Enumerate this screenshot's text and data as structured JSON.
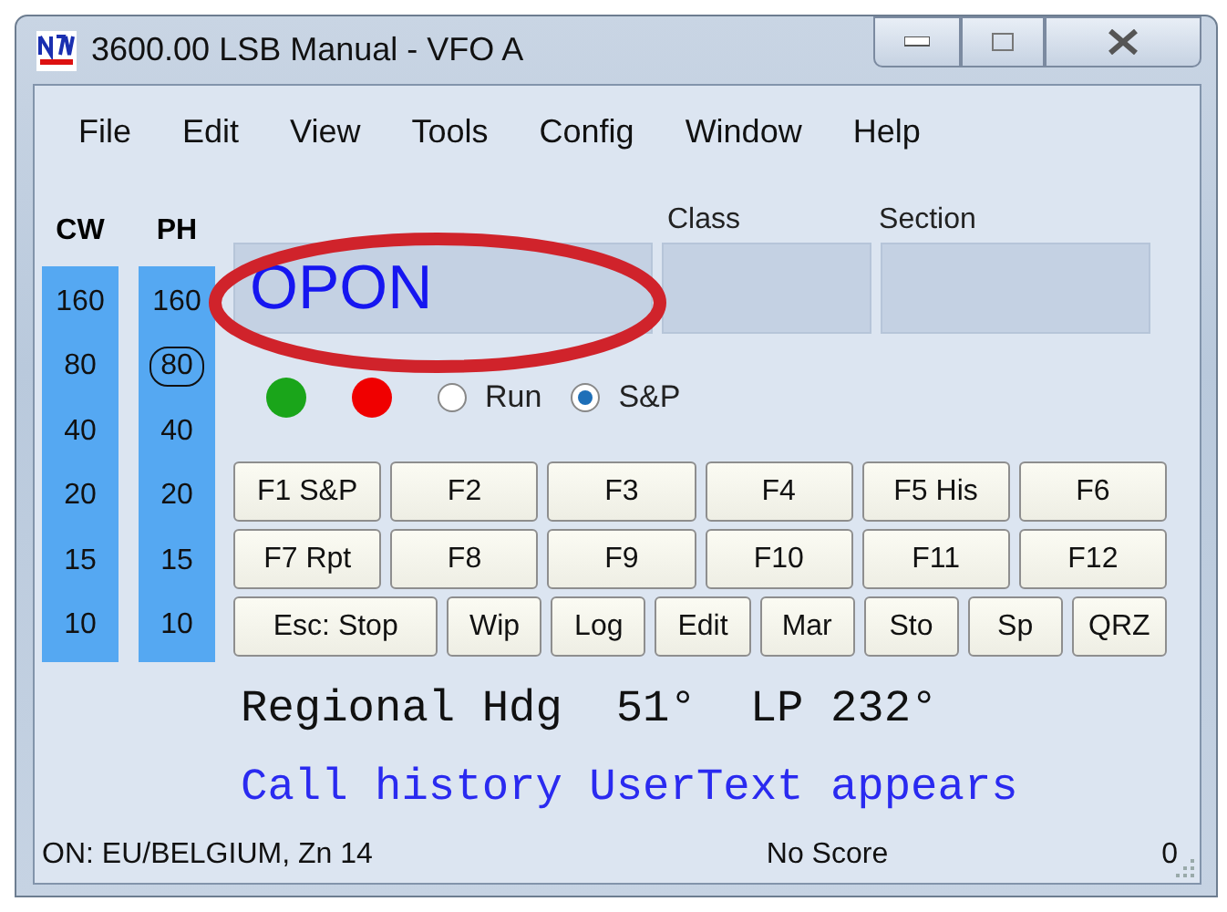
{
  "window": {
    "title": "3600.00 LSB Manual - VFO A"
  },
  "menu": [
    "File",
    "Edit",
    "View",
    "Tools",
    "Config",
    "Window",
    "Help"
  ],
  "bands": [
    {
      "header": "CW",
      "items": [
        {
          "label": "160",
          "selected": false
        },
        {
          "label": "80",
          "selected": false
        },
        {
          "label": "40",
          "selected": false
        },
        {
          "label": "20",
          "selected": false
        },
        {
          "label": "15",
          "selected": false
        },
        {
          "label": "10",
          "selected": false
        }
      ]
    },
    {
      "header": "PH",
      "items": [
        {
          "label": "160",
          "selected": false
        },
        {
          "label": "80",
          "selected": true
        },
        {
          "label": "40",
          "selected": false
        },
        {
          "label": "20",
          "selected": false
        },
        {
          "label": "15",
          "selected": false
        },
        {
          "label": "10",
          "selected": false
        }
      ]
    }
  ],
  "entry": {
    "call": "OPON",
    "class_label": "Class",
    "section_label": "Section"
  },
  "indicators": [
    {
      "color": "#1aa51a"
    },
    {
      "color": "#f00000"
    }
  ],
  "mode": [
    {
      "label": "Run",
      "selected": false
    },
    {
      "label": "S&P",
      "selected": true
    }
  ],
  "button_rows": [
    [
      "F1 S&P",
      "F2",
      "F3",
      "F4",
      "F5 His",
      "F6"
    ],
    [
      "F7 Rpt",
      "F8",
      "F9",
      "F10",
      "F11",
      "F12"
    ],
    [
      "Esc: Stop",
      "Wip",
      "Log",
      "Edit",
      "Mar",
      "Sto",
      "Sp",
      "QRZ"
    ]
  ],
  "info": {
    "heading": "Regional Hdg  51°  LP 232°",
    "user_text": "Call history UserText appears"
  },
  "status_bar": {
    "location": "ON: EU/BELGIUM, Zn 14",
    "score": "No Score",
    "count": "0"
  }
}
